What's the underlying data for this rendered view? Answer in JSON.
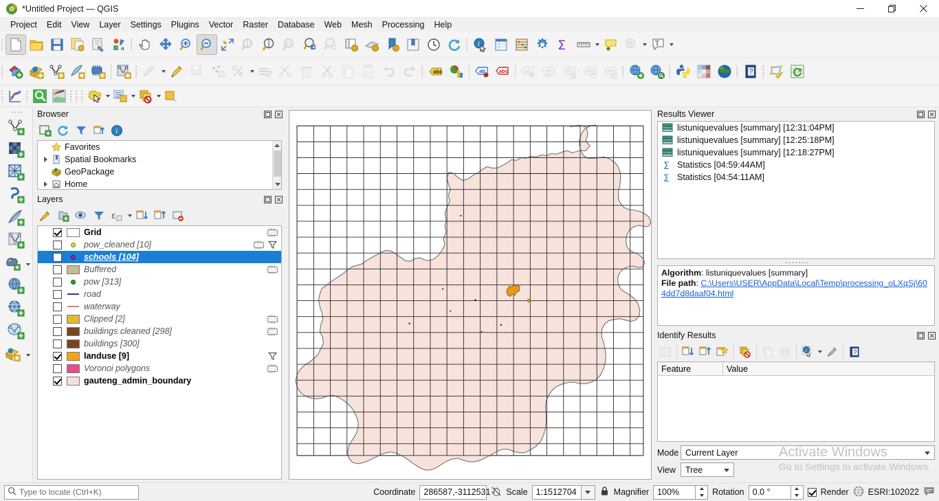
{
  "window": {
    "title": "*Untitled Project — QGIS",
    "minimize": "—",
    "maximize": "❐",
    "close": "✕"
  },
  "menubar": [
    {
      "label": "Project",
      "accel": "P"
    },
    {
      "label": "Edit",
      "accel": "E"
    },
    {
      "label": "View",
      "accel": "V"
    },
    {
      "label": "Layer",
      "accel": "L"
    },
    {
      "label": "Settings",
      "accel": "S"
    },
    {
      "label": "Plugins",
      "accel": "P"
    },
    {
      "label": "Vector",
      "accel": "o"
    },
    {
      "label": "Raster",
      "accel": "R"
    },
    {
      "label": "Database",
      "accel": "D"
    },
    {
      "label": "Web",
      "accel": "W"
    },
    {
      "label": "Mesh",
      "accel": "M"
    },
    {
      "label": "Processing",
      "accel": "c"
    },
    {
      "label": "Help",
      "accel": "H"
    }
  ],
  "browser": {
    "title": "Browser",
    "tools": [
      "add-layer-icon",
      "refresh-icon",
      "filter-icon",
      "collapse-all-icon",
      "properties-icon"
    ],
    "items": [
      {
        "label": "Favorites",
        "icon": "star-icon",
        "expandable": false
      },
      {
        "label": "Spatial Bookmarks",
        "icon": "bookmark-icon",
        "expandable": true
      },
      {
        "label": "GeoPackage",
        "icon": "geopackage-icon",
        "expandable": false
      },
      {
        "label": "Home",
        "icon": "home-icon",
        "expandable": true
      }
    ]
  },
  "layers": {
    "title": "Layers",
    "tools": [
      "open-layer-styling-icon",
      "add-group-icon",
      "manage-visibility-icon",
      "filter-legend-icon",
      "expression-filter-icon",
      "expand-all-icon",
      "collapse-all-icon",
      "remove-layer-icon"
    ],
    "items": [
      {
        "label": "Grid",
        "checked": true,
        "selected": false,
        "italic": false,
        "symbol": "polygon",
        "color": "#ffffff",
        "badges": [
          "edit-icon"
        ]
      },
      {
        "label": "pow_cleaned [10]",
        "checked": false,
        "selected": false,
        "italic": true,
        "symbol": "point",
        "color": "#d6e22b",
        "badges": [
          "edit-icon",
          "filter-icon"
        ]
      },
      {
        "label": "schools [104]",
        "checked": false,
        "selected": true,
        "italic": true,
        "symbol": "point",
        "color": "#8c2aa8",
        "badges": []
      },
      {
        "label": "Buffered",
        "checked": false,
        "selected": false,
        "italic": true,
        "symbol": "polygon",
        "color": "#c8bb93",
        "badges": [
          "edit-icon"
        ]
      },
      {
        "label": "pow [313]",
        "checked": false,
        "selected": false,
        "italic": true,
        "symbol": "point",
        "color": "#24a424",
        "badges": []
      },
      {
        "label": "road",
        "checked": false,
        "selected": false,
        "italic": true,
        "symbol": "line",
        "color": "#3a3a8c",
        "badges": []
      },
      {
        "label": "waterway",
        "checked": false,
        "selected": false,
        "italic": true,
        "symbol": "line",
        "color": "#e07a7a",
        "badges": []
      },
      {
        "label": "Clipped [2]",
        "checked": false,
        "selected": false,
        "italic": true,
        "symbol": "polygon",
        "color": "#e3b92f",
        "badges": [
          "edit-icon"
        ]
      },
      {
        "label": "buildings cleaned [298]",
        "checked": false,
        "selected": false,
        "italic": true,
        "symbol": "polygon",
        "color": "#7a4420",
        "badges": [
          "edit-icon"
        ]
      },
      {
        "label": "buildings [300]",
        "checked": false,
        "selected": false,
        "italic": true,
        "symbol": "polygon",
        "color": "#7a4420",
        "badges": []
      },
      {
        "label": "landuse [9]",
        "checked": true,
        "selected": false,
        "italic": false,
        "symbol": "polygon",
        "color": "#f5a11c",
        "badges": [
          "filter-icon"
        ]
      },
      {
        "label": "Voronoi polygons",
        "checked": false,
        "selected": false,
        "italic": true,
        "symbol": "polygon",
        "color": "#e34f8a",
        "badges": [
          "edit-icon"
        ]
      },
      {
        "label": "gauteng_admin_boundary",
        "checked": true,
        "selected": false,
        "italic": false,
        "symbol": "polygon",
        "color": "#f7dfd9",
        "badges": []
      }
    ]
  },
  "results_viewer": {
    "title": "Results Viewer",
    "items": [
      {
        "label": "listuniquevalues [summary] [12:31:04PM]",
        "icon": "table-result-icon"
      },
      {
        "label": "listuniquevalues [summary] [12:25:18PM]",
        "icon": "table-result-icon"
      },
      {
        "label": "listuniquevalues [summary] [12:18:27PM]",
        "icon": "table-result-icon"
      },
      {
        "label": "Statistics [04:59:44AM]",
        "icon": "sigma-icon"
      },
      {
        "label": "Statistics [04:54:11AM]",
        "icon": "sigma-icon"
      }
    ],
    "detail": {
      "algorithm_label": "Algorithm",
      "algorithm_value": "listuniquevalues [summary]",
      "filepath_label": "File path",
      "filepath_value": "C:\\Users\\USER\\AppData\\Local\\Temp\\processing_oLXqSj\\604dd7d8daaf04.html"
    }
  },
  "identify_results": {
    "title": "Identify Results",
    "tools": [
      "expand-tree-icon",
      "expand-new-icon",
      "collapse-new-icon",
      "highlight-icon",
      "clear-results-icon",
      "copy-icon",
      "print-icon",
      "identify-mode-icon",
      "settings-icon",
      "help-icon"
    ],
    "columns": [
      "Feature",
      "Value"
    ],
    "mode_label": "Mode",
    "mode_value": "Current Layer",
    "view_label": "View",
    "view_value": "Tree"
  },
  "watermark": {
    "line1": "Activate Windows",
    "line2": "Go to Settings to activate Windows."
  },
  "statusbar": {
    "locate_placeholder": "Type to locate (Ctrl+K)",
    "coordinate_label": "Coordinate",
    "coordinate_value": "286587,-3112531",
    "scale_label": "Scale",
    "scale_value": "1:1512704",
    "magnifier_label": "Magnifier",
    "magnifier_value": "100%",
    "rotation_label": "Rotation",
    "rotation_value": "0.0 °",
    "render_label": "Render",
    "render_checked": true,
    "crs_value": "ESRI:102022",
    "lock_icon": "lock-icon",
    "messages_icon": "messages-icon",
    "globe_icon": "globe-icon"
  },
  "map": {
    "boundary_fill": "#f7e2dc",
    "boundary_stroke": "#5a5a5a",
    "grid_stroke": "#2a2a2a",
    "landuse_fill": "#e89a1c",
    "point_color": "#4a2a14"
  }
}
